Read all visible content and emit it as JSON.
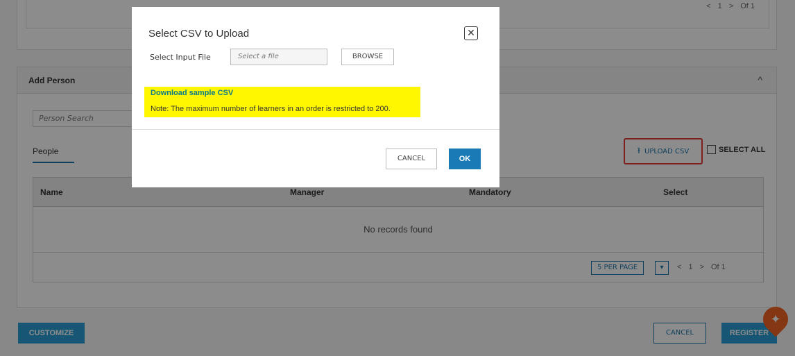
{
  "top_pager": {
    "prev": "<",
    "page": "1",
    "next": ">",
    "total": "Of 1"
  },
  "add_person": {
    "title": "Add Person",
    "caret": "^",
    "search_placeholder": "Person Search",
    "tab": "People",
    "upload_label": "UPLOAD CSV",
    "select_all": "SELECT ALL",
    "columns": [
      "Name",
      "Manager",
      "Mandatory",
      "Select"
    ],
    "empty_text": "No records found",
    "per_page": "5 PER PAGE",
    "pager": {
      "prev": "<",
      "page": "1",
      "next": ">",
      "total": "Of 1"
    }
  },
  "footer": {
    "customize": "CUSTOMIZE",
    "cancel": "CANCEL",
    "register": "REGISTER"
  },
  "modal": {
    "title": "Select CSV to Upload",
    "close": "✕",
    "input_label": "Select Input File",
    "file_placeholder": "Select a file",
    "browse": "BROWSE",
    "sample_link": "Download sample CSV",
    "note": "Note: The maximum number of learners in an order is restricted to 200.",
    "cancel": "CANCEL",
    "ok": "OK"
  },
  "colors": {
    "primary": "#1a73a8",
    "highlight": "#fff700",
    "annotation": "#e53935",
    "fab": "#f26322"
  }
}
